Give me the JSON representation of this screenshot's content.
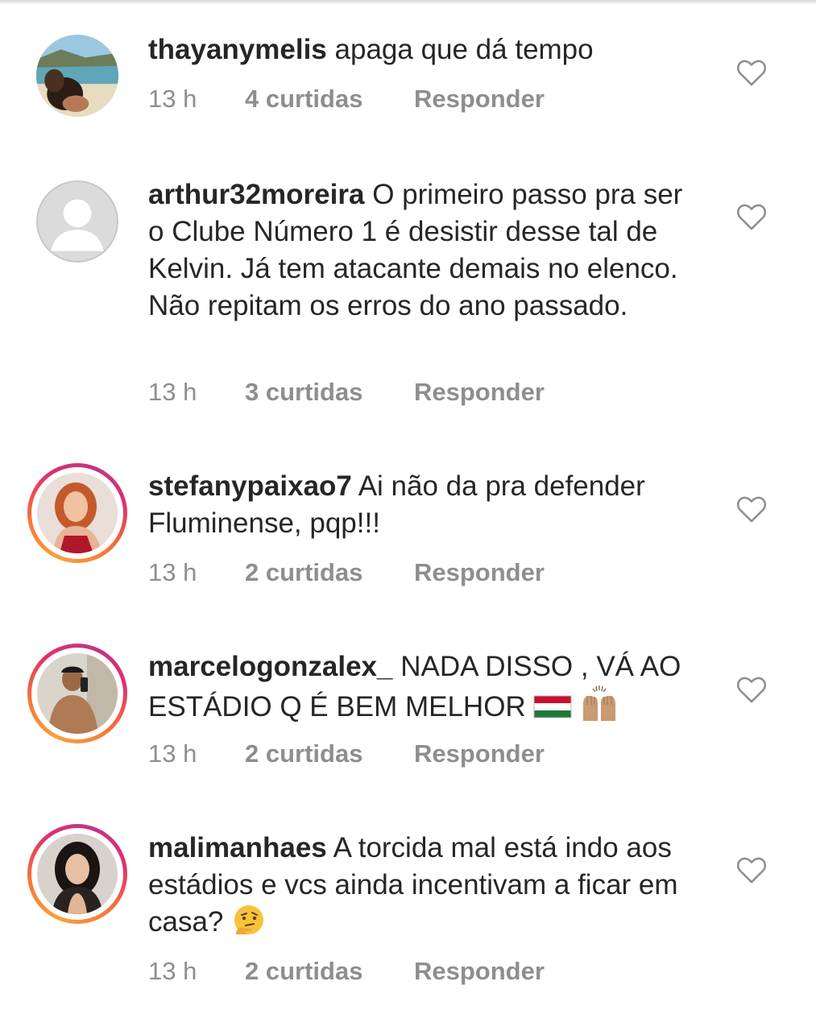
{
  "comments": [
    {
      "username": "thayanymelis",
      "text": "apaga que dá tempo",
      "time": "13 h",
      "likes": "4 curtidas",
      "reply": "Responder",
      "avatar": "beach-photo",
      "story_ring": false
    },
    {
      "username": "arthur32moreira",
      "text": "O primeiro passo pra ser o Clube Número 1 é desistir desse tal de Kelvin. Já tem atacante demais no elenco. Não repitam os erros do ano passado.",
      "time": "13 h",
      "likes": "3 curtidas",
      "reply": "Responder",
      "avatar": "default-placeholder",
      "story_ring": false
    },
    {
      "username": "stefanypaixao7",
      "text": "Ai não da pra defender Fluminense, pqp!!!",
      "time": "13 h",
      "likes": "2 curtidas",
      "reply": "Responder",
      "avatar": "woman-red-hair-photo",
      "story_ring": true
    },
    {
      "username": "marcelogonzalex_",
      "text": "NADA DISSO , VÁ AO ESTÁDIO Q É BEM MELHOR",
      "emoji": [
        "fluminense-flag-emoji",
        "raising-hands-emoji"
      ],
      "time": "13 h",
      "likes": "2 curtidas",
      "reply": "Responder",
      "avatar": "man-selfie-photo",
      "story_ring": true
    },
    {
      "username": "malimanhaes",
      "text": "A torcida mal está indo aos estádios e vcs ainda incentivam a ficar em casa?",
      "emoji": [
        "thinking-face-emoji"
      ],
      "time": "13 h",
      "likes": "2 curtidas",
      "reply": "Responder",
      "avatar": "woman-dark-hair-photo",
      "story_ring": true
    }
  ],
  "icons": {
    "like": "heart-outline-icon"
  },
  "colors": {
    "text": "#262626",
    "meta": "#8e8e8e",
    "story_ring": [
      "#f9a23b",
      "#e1306c",
      "#c13584"
    ]
  }
}
